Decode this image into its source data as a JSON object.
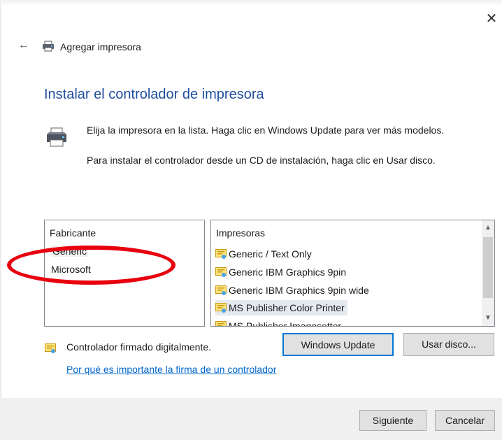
{
  "window": {
    "title": "Agregar impresora",
    "close_glyph": "✕",
    "back_glyph": "←"
  },
  "page": {
    "title": "Instalar el controlador de impresora",
    "description_1": "Elija la impresora en la lista. Haga clic en Windows Update para ver más modelos.",
    "description_2": "Para instalar el controlador desde un CD de instalación, haga clic en Usar disco."
  },
  "manufacturers": {
    "header": "Fabricante",
    "items": [
      {
        "label": "Generic",
        "selected": true
      },
      {
        "label": "Microsoft",
        "selected": false
      }
    ]
  },
  "printers": {
    "header": "Impresoras",
    "items": [
      {
        "label": "Generic / Text Only",
        "selected": false
      },
      {
        "label": "Generic IBM Graphics 9pin",
        "selected": false
      },
      {
        "label": "Generic IBM Graphics 9pin wide",
        "selected": false
      },
      {
        "label": "MS Publisher Color Printer",
        "selected": true
      },
      {
        "label": "MS Publisher Imagesetter",
        "selected": false
      }
    ],
    "scroll_up_glyph": "▲",
    "scroll_down_glyph": "▼"
  },
  "signature": {
    "text": "Controlador firmado digitalmente.",
    "link": "Por qué es importante la firma de un controlador"
  },
  "buttons": {
    "windows_update": "Windows Update",
    "use_disk": "Usar disco...",
    "next": "Siguiente",
    "cancel": "Cancelar"
  },
  "icons": {
    "printer": "printer-icon",
    "driver": "driver-certificate-icon"
  },
  "colors": {
    "title_blue": "#1f4e9e",
    "link_blue": "#0066cc",
    "focus_border": "#0078d7",
    "annotation_red": "#e8000e",
    "footer_bg": "#f0f0f0"
  }
}
